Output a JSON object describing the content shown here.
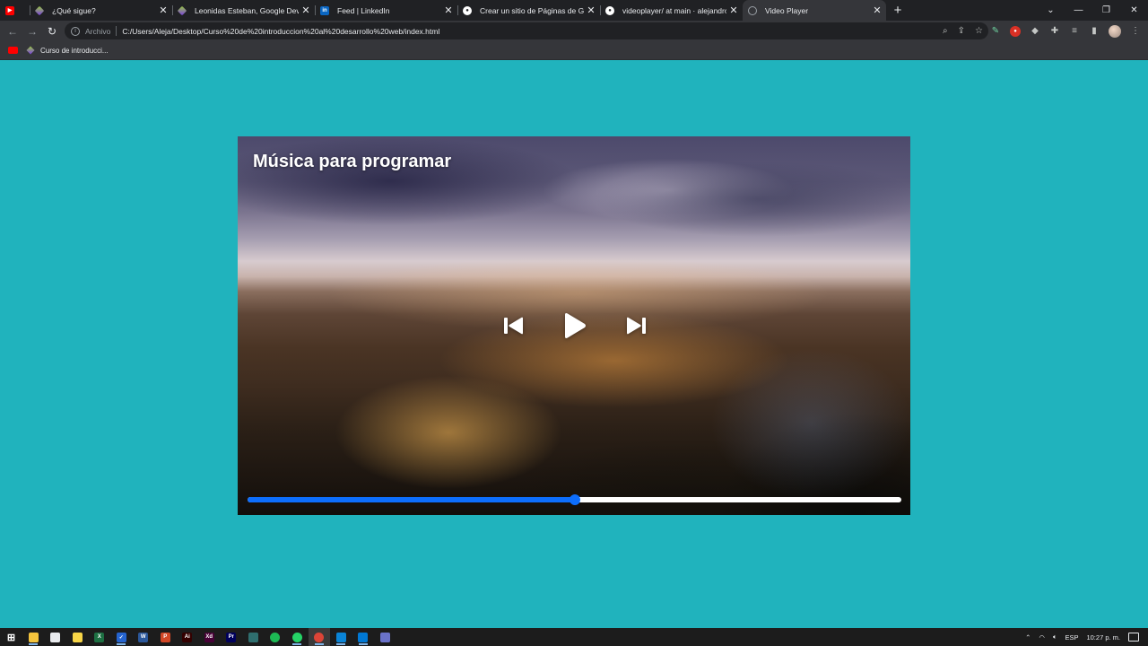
{
  "browser": {
    "tabs": [
      {
        "title": "",
        "favicon": "youtube-icon",
        "active": false
      },
      {
        "title": "¿Qué sigue?",
        "favicon": "platzi-icon",
        "active": false
      },
      {
        "title": "Leonidas Esteban, Google Develo",
        "favicon": "platzi-icon",
        "active": false
      },
      {
        "title": "Feed | LinkedIn",
        "favicon": "linkedin-icon",
        "active": false
      },
      {
        "title": "Crear un sitio de Páginas de GitH",
        "favicon": "github-icon",
        "active": false
      },
      {
        "title": "videoplayer/ at main · alejandrog",
        "favicon": "github-icon",
        "active": false
      },
      {
        "title": "Video Player",
        "favicon": "globe-icon",
        "active": true
      }
    ],
    "address": {
      "scheme_label": "Archivo",
      "url": "C:/Users/Aleja/Desktop/Curso%20de%20introduccion%20al%20desarrollo%20web/index.html"
    },
    "bookmarks": [
      {
        "label": "",
        "icon": "youtube-icon"
      },
      {
        "label": "Curso de introducci...",
        "icon": "platzi-icon"
      }
    ]
  },
  "player": {
    "title": "Música para programar",
    "progress": 0.5,
    "colors": {
      "accent": "#0d6efd",
      "track": "#ffffff",
      "page_bg": "#20b3bd"
    }
  },
  "taskbar": {
    "apps": [
      "windows-start-icon",
      "file-explorer-icon",
      "store-icon",
      "sticky-notes-icon",
      "excel-icon",
      "todo-icon",
      "word-icon",
      "powerpoint-icon",
      "illustrator-icon",
      "xd-icon",
      "premiere-icon",
      "app-icon",
      "spotify-icon",
      "whatsapp-icon",
      "chrome-icon",
      "mail-icon",
      "vscode-icon",
      "security-icon"
    ],
    "tray": {
      "language": "ESP",
      "time": "10:27 p. m."
    }
  }
}
